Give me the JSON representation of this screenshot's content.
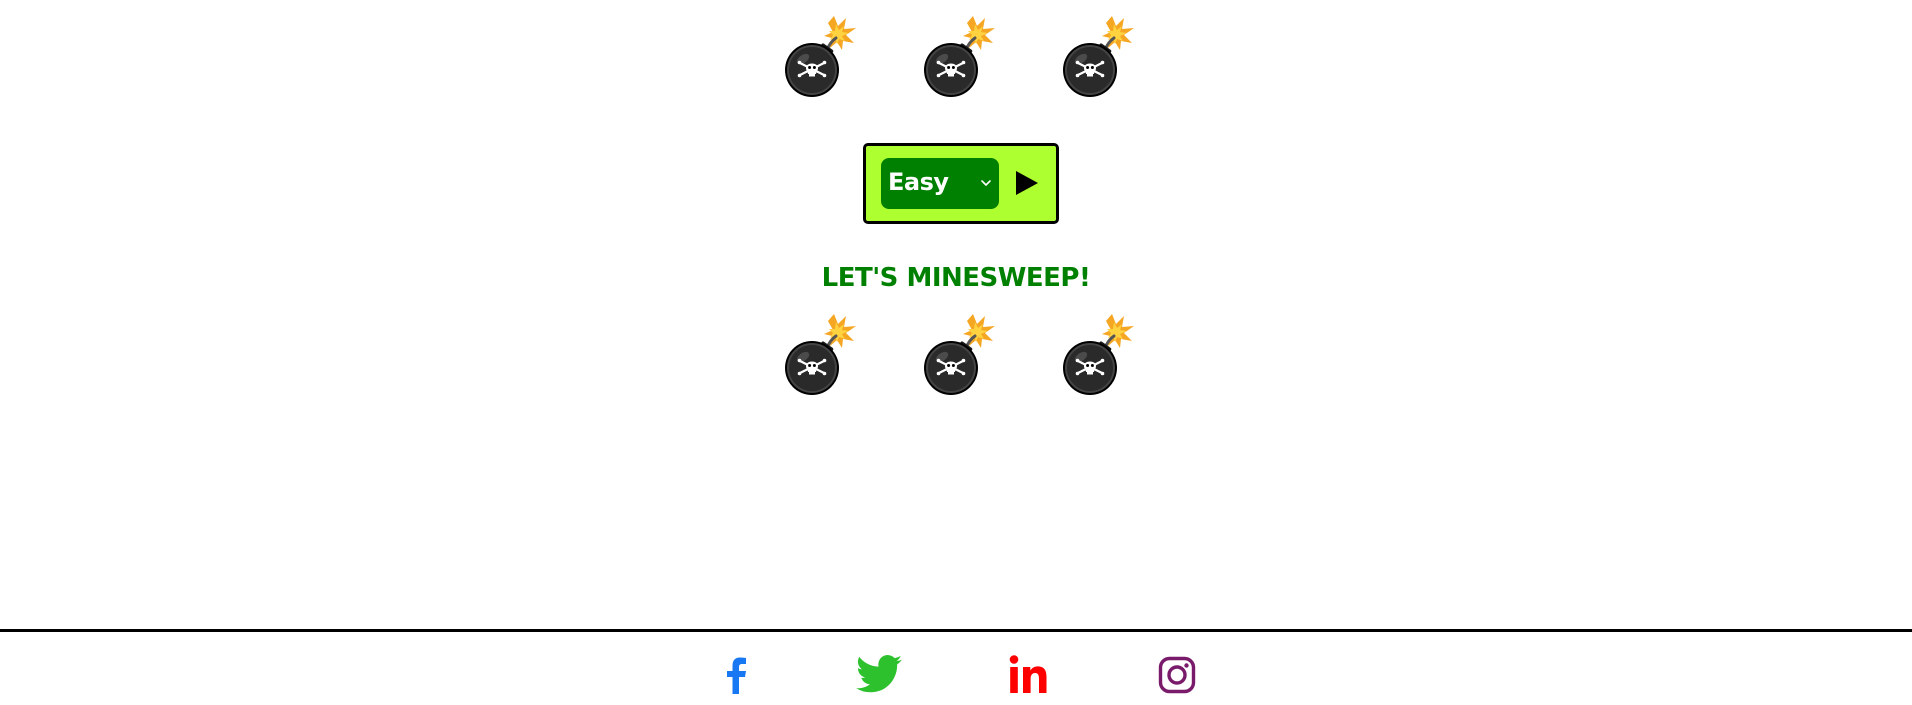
{
  "game": {
    "difficulty": {
      "selected": "Easy"
    },
    "title": "LET'S MINESWEEP!",
    "play_icon": "play-triangle-icon",
    "bomb_icon": "bomb-skull-icon"
  },
  "footer": {
    "links": [
      {
        "icon": "facebook-icon",
        "color": "#1877f2"
      },
      {
        "icon": "twitter-icon",
        "color": "#2ec12e"
      },
      {
        "icon": "linkedin-icon",
        "color": "#ff0000"
      },
      {
        "icon": "instagram-icon",
        "color": "#7a1a6a"
      }
    ]
  },
  "colors": {
    "panel_bg": "#adff2f",
    "select_bg": "#008000",
    "title": "#008000"
  }
}
